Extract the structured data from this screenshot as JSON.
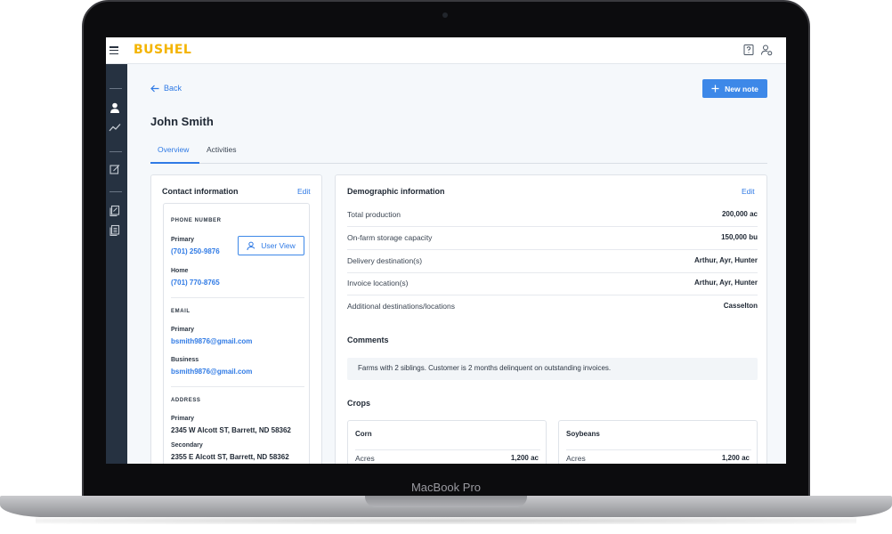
{
  "device": {
    "label": "MacBook Pro"
  },
  "app": {
    "logo": "BUSHEL"
  },
  "header": {
    "back_label": "Back",
    "new_note_label": "New note",
    "contact_name": "John Smith"
  },
  "tabs": [
    {
      "label": "Overview",
      "active": true
    },
    {
      "label": "Activities",
      "active": false
    }
  ],
  "contact": {
    "title": "Contact information",
    "edit_label": "Edit",
    "user_view_label": "User View",
    "phone": {
      "heading": "PHONE NUMBER",
      "primary_label": "Primary",
      "primary": "(701) 250-9876",
      "home_label": "Home",
      "home": "(701) 770-8765"
    },
    "email": {
      "heading": "EMAIL",
      "primary_label": "Primary",
      "primary": "bsmith9876@gmail.com",
      "business_label": "Business",
      "business": "bsmith9876@gmail.com"
    },
    "address": {
      "heading": "ADDRESS",
      "primary_label": "Primary",
      "primary": "2345 W Alcott ST, Barrett, ND 58362",
      "secondary_label": "Secondary",
      "secondary": "2355 E Alcott ST, Barrett, ND 58362"
    }
  },
  "demographic": {
    "title": "Demographic information",
    "edit_label": "Edit",
    "rows": [
      {
        "label": "Total production",
        "value": "200,000 ac"
      },
      {
        "label": "On-farm storage capacity",
        "value": "150,000 bu"
      },
      {
        "label": "Delivery destination(s)",
        "value": "Arthur, Ayr, Hunter"
      },
      {
        "label": "Invoice location(s)",
        "value": "Arthur, Ayr, Hunter"
      },
      {
        "label": "Additional destinations/locations",
        "value": "Casselton"
      }
    ]
  },
  "comments": {
    "title": "Comments",
    "text": "Farms with 2 siblings. Customer is 2 months delinquent on outstanding invoices."
  },
  "crops": {
    "title": "Crops",
    "items": [
      {
        "name": "Corn",
        "row_label": "Acres",
        "row_value": "1,200 ac"
      },
      {
        "name": "Soybeans",
        "row_label": "Acres",
        "row_value": "1,200 ac"
      }
    ]
  },
  "icons": {
    "menu": "hamburger-icon",
    "help": "help-icon",
    "account": "user-settings-icon",
    "sidebar": [
      "user-icon",
      "trend-chart-icon",
      "edit-note-icon",
      "contracts-icon",
      "documents-icon"
    ]
  },
  "colors": {
    "brand": "#f4b400",
    "accent": "#2f7ae5",
    "sidebar": "#263241"
  }
}
